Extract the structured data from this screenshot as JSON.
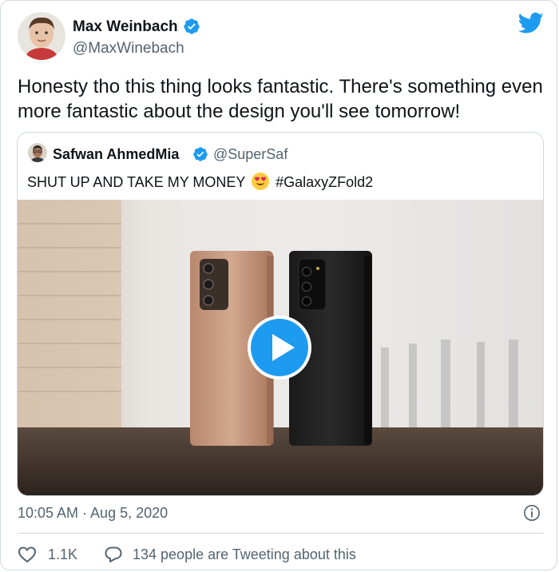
{
  "tweet": {
    "display_name": "Max Weinbach",
    "handle": "@MaxWinebach",
    "text": "Honesty tho this thing looks fantastic. There's something even more fantastic about the design you'll see tomorrow!",
    "timestamp": "10:05 AM · Aug 5, 2020",
    "likes": "1.1K",
    "tweeting_about": "134 people are Tweeting about this"
  },
  "quoted": {
    "display_name": "Safwan AhmedMia",
    "handle": "@SuperSaf",
    "text_before": "SHUT UP AND TAKE MY MONEY",
    "text_after": "#GalaxyZFold2",
    "emoji": "heart-eyes-emoji"
  },
  "colors": {
    "twitter_blue": "#1d9bf0",
    "secondary_text": "#536471",
    "border": "#cfd9de"
  },
  "icons": [
    "verified-badge-icon",
    "twitter-bird-icon",
    "play-icon",
    "info-icon",
    "heart-icon",
    "reply-icon"
  ]
}
